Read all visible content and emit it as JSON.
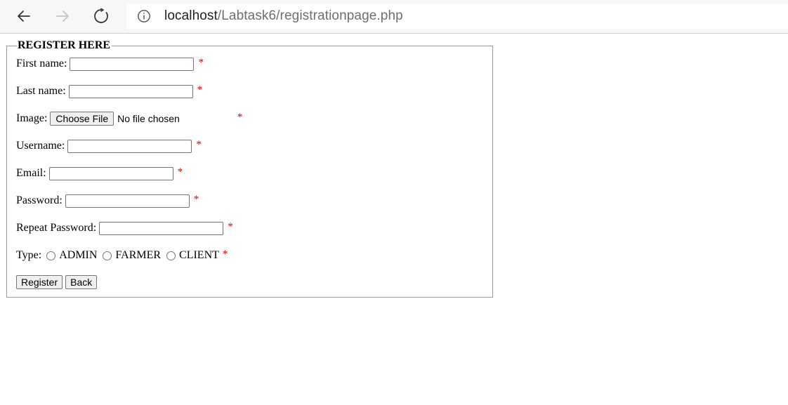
{
  "browser": {
    "back_icon": "arrow-left-icon",
    "forward_icon": "arrow-right-icon",
    "reload_icon": "reload-icon",
    "info_icon": "info-circle-icon",
    "url_host": "localhost",
    "url_path": "/Labtask6/registrationpage.php"
  },
  "form": {
    "legend": "REGISTER HERE",
    "required_mark": "*",
    "fields": {
      "first_name": {
        "label": "First name:",
        "value": ""
      },
      "last_name": {
        "label": "Last name:",
        "value": ""
      },
      "image": {
        "label": "Image:",
        "button": "Choose File",
        "status": "No file chosen"
      },
      "username": {
        "label": "Username:",
        "value": ""
      },
      "email": {
        "label": "Email:",
        "value": ""
      },
      "password": {
        "label": "Password:",
        "value": ""
      },
      "repeat_password": {
        "label": "Repeat Password:",
        "value": ""
      },
      "type": {
        "label": "Type:",
        "options": [
          "ADMIN",
          "FARMER",
          "CLIENT"
        ],
        "selected": null
      }
    },
    "buttons": {
      "register": "Register",
      "back": "Back"
    }
  },
  "colors": {
    "required": "#e00000",
    "chrome_bg": "#f7f7f7"
  }
}
